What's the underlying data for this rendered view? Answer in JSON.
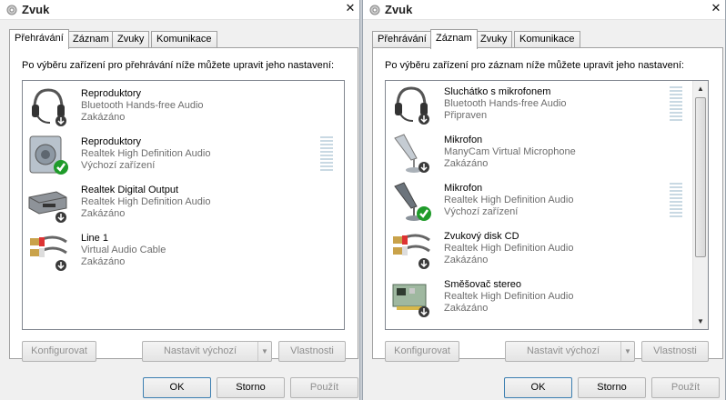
{
  "left": {
    "title": "Zvuk",
    "close_glyph": "✕",
    "tabs": [
      {
        "label": "Přehrávání",
        "active": true
      },
      {
        "label": "Záznam",
        "active": false
      },
      {
        "label": "Zvuky",
        "active": false
      },
      {
        "label": "Komunikace",
        "active": false
      }
    ],
    "instruction": "Po výběru zařízení pro přehrávání níže můžete upravit jeho nastavení:",
    "devices": [
      {
        "name": "Reproduktory",
        "desc": "Bluetooth Hands-free Audio",
        "status": "Zakázáno",
        "icon": "headset-icon",
        "badge": "disabled-arrow-icon"
      },
      {
        "name": "Reproduktory",
        "desc": "Realtek High Definition Audio",
        "status": "Výchozí zařízení",
        "icon": "speaker-icon",
        "badge": "default-check-icon"
      },
      {
        "name": "Realtek Digital Output",
        "desc": "Realtek High Definition Audio",
        "status": "Zakázáno",
        "icon": "digital-output-icon",
        "badge": "disabled-arrow-icon"
      },
      {
        "name": "Line 1",
        "desc": "Virtual Audio Cable",
        "status": "Zakázáno",
        "icon": "rca-cable-icon",
        "badge": "disabled-arrow-icon"
      }
    ],
    "buttons": {
      "configure": "Konfigurovat",
      "set_default": "Nastavit výchozí",
      "properties": "Vlastnosti",
      "ok": "OK",
      "cancel": "Storno",
      "apply": "Použít"
    }
  },
  "right": {
    "title": "Zvuk",
    "close_glyph": "✕",
    "tabs": [
      {
        "label": "Přehrávání",
        "active": false
      },
      {
        "label": "Záznam",
        "active": true
      },
      {
        "label": "Zvuky",
        "active": false
      },
      {
        "label": "Komunikace",
        "active": false
      }
    ],
    "instruction": "Po výběru zařízení pro záznam níže můžete upravit jeho nastavení:",
    "devices": [
      {
        "name": "Sluchátko s mikrofonem",
        "desc": "Bluetooth Hands-free Audio",
        "status": "Připraven",
        "icon": "headset-icon",
        "badge": "disabled-arrow-icon"
      },
      {
        "name": "Mikrofon",
        "desc": "ManyCam Virtual Microphone",
        "status": "Zakázáno",
        "icon": "microphone-icon",
        "badge": "disabled-arrow-icon"
      },
      {
        "name": "Mikrofon",
        "desc": "Realtek High Definition Audio",
        "status": "Výchozí zařízení",
        "icon": "microphone-icon",
        "badge": "default-check-icon"
      },
      {
        "name": "Zvukový disk CD",
        "desc": "Realtek High Definition Audio",
        "status": "Zakázáno",
        "icon": "rca-cable-icon",
        "badge": "disabled-arrow-icon"
      },
      {
        "name": "Směšovač stereo",
        "desc": "Realtek High Definition Audio",
        "status": "Zakázáno",
        "icon": "sound-card-icon",
        "badge": "disabled-arrow-icon"
      }
    ],
    "buttons": {
      "configure": "Konfigurovat",
      "set_default": "Nastavit výchozí",
      "properties": "Vlastnosti",
      "ok": "OK",
      "cancel": "Storno",
      "apply": "Použít"
    }
  }
}
